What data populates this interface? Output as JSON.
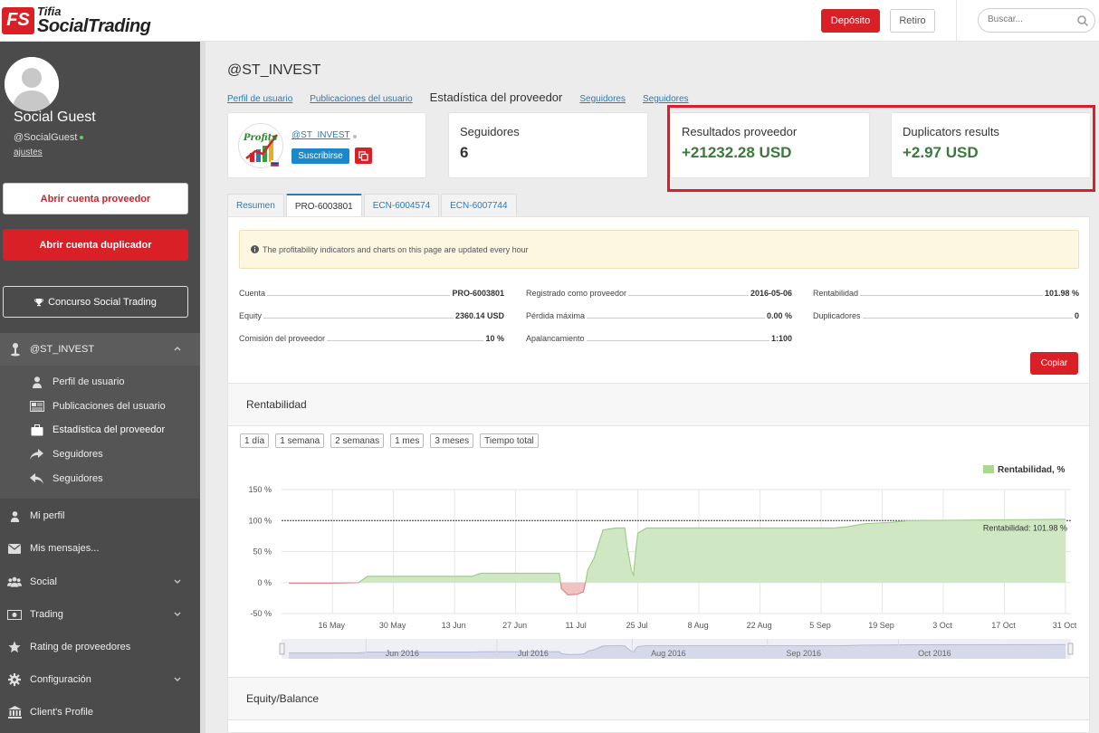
{
  "brand": {
    "line1": "Tifia",
    "line2": "SocialTrading"
  },
  "header": {
    "deposit_label": "Depósito",
    "withdraw_label": "Retiro",
    "search_placeholder": "Buscar..."
  },
  "user": {
    "name": "Social Guest",
    "handle": "@SocialGuest",
    "settings_link": "ajustes"
  },
  "sidebar": {
    "open_provider": "Abrir cuenta proveedor",
    "open_duplicator": "Abrir cuenta duplicador",
    "contest": "Concurso Social Trading",
    "section": {
      "label": "@ST_INVEST",
      "icon": "user-pin-icon"
    },
    "sub_items": [
      {
        "label": "Perfil de usuario",
        "icon": "user-icon"
      },
      {
        "label": "Publicaciones del usuario",
        "icon": "newspaper-icon"
      },
      {
        "label": "Estadística del proveedor",
        "icon": "briefcase-icon"
      },
      {
        "label": "Seguidores",
        "icon": "share-icon"
      },
      {
        "label": "Seguidores",
        "icon": "reply-icon"
      }
    ],
    "items": [
      {
        "label": "Mi perfil",
        "icon": "user-icon"
      },
      {
        "label": "Mis mensajes...",
        "icon": "envelope-icon"
      },
      {
        "label": "Social",
        "icon": "users-icon"
      },
      {
        "label": "Trading",
        "icon": "money-icon"
      },
      {
        "label": "Rating de proveedores",
        "icon": "star-icon"
      },
      {
        "label": "Configuración",
        "icon": "gear-icon"
      },
      {
        "label": "Client's Profile",
        "icon": "bank-icon"
      }
    ]
  },
  "page": {
    "title": "@ST_INVEST",
    "subnav": {
      "profile": "Perfil de usuario",
      "posts": "Publicaciones del usuario",
      "current": "Estadística del proveedor",
      "followers1": "Seguidores",
      "followers2": "Seguidores"
    }
  },
  "provider": {
    "name": "@ST_INVEST",
    "subscribe_label": "Suscribirse",
    "logo_text": "Profits"
  },
  "cards": {
    "followers": {
      "label": "Seguidores",
      "value": "6"
    },
    "provider_results": {
      "label": "Resultados proveedor",
      "value": "+21232.28 USD"
    },
    "duplicators_results": {
      "label": "Duplicators results",
      "value": "+2.97 USD"
    }
  },
  "tabs": [
    "Resumen",
    "PRO-6003801",
    "ECN-6004574",
    "ECN-6007744"
  ],
  "notice": "The profitability indicators and charts on this page are updated every hour",
  "stats": {
    "col1": [
      {
        "k": "Cuenta",
        "v": "PRO-6003801"
      },
      {
        "k": "Equity",
        "v": "2360.14 USD"
      },
      {
        "k": "Comisión del proveedor",
        "v": "10 %"
      }
    ],
    "col2": [
      {
        "k": "Registrado como proveedor",
        "v": "2016-05-06"
      },
      {
        "k": "Pérdida máxima",
        "v": "0.00 %"
      },
      {
        "k": "Apalancamiento",
        "v": "1:100"
      }
    ],
    "col3": [
      {
        "k": "Rentabilidad",
        "v": "101.98 %"
      },
      {
        "k": "Duplicadores",
        "v": "0"
      }
    ]
  },
  "copy_label": "Copiar",
  "sections": {
    "profitability": "Rentabilidad",
    "equity": "Equity/Balance"
  },
  "ranges": [
    "1 día",
    "1 semana",
    "2 semanas",
    "1 mes",
    "3 meses",
    "Tiempo total"
  ],
  "colors": {
    "accent": "#d92027",
    "link": "#2a7ab8",
    "positive": "#3b7a3b",
    "area_pos": "#cfe8c3",
    "area_neg": "#f0c3c3"
  },
  "chart_data": {
    "type": "area",
    "legend": "Rentabilidad, %",
    "legend_position": "top-right",
    "annotation": "Rentabilidad: 101.98 %",
    "reference_line": 100,
    "ylim": [
      -50,
      150
    ],
    "y_ticks": [
      -50,
      0,
      50,
      100,
      150
    ],
    "y_tick_labels": [
      "-50 %",
      "0 %",
      "50 %",
      "100 %",
      "150 %"
    ],
    "x_tick_labels": [
      "16 May",
      "30 May",
      "13 Jun",
      "27 Jun",
      "11 Jul",
      "25 Jul",
      "8 Aug",
      "22 Aug",
      "5 Sep",
      "19 Sep",
      "3 Oct",
      "17 Oct",
      "31 Oct"
    ],
    "x_tick_days": [
      10,
      24,
      38,
      52,
      66,
      80,
      94,
      108,
      122,
      136,
      150,
      164,
      178
    ],
    "xlim_days": [
      0,
      178
    ],
    "x_origin_date": "2016-05-06",
    "navigator_labels": [
      "Jun 2016",
      "Jul 2016",
      "Aug 2016",
      "Sep 2016",
      "Oct 2016"
    ],
    "navigator_days": [
      26,
      56,
      87,
      118,
      148
    ],
    "points": [
      [
        0,
        -1
      ],
      [
        10,
        -1
      ],
      [
        16,
        0
      ],
      [
        18,
        10
      ],
      [
        42,
        10
      ],
      [
        44,
        15
      ],
      [
        60,
        15
      ],
      [
        62,
        15
      ],
      [
        62.5,
        -10
      ],
      [
        64,
        -20
      ],
      [
        66,
        -19
      ],
      [
        67.5,
        -15
      ],
      [
        68,
        0
      ],
      [
        68.5,
        20
      ],
      [
        70,
        40
      ],
      [
        72,
        85
      ],
      [
        75,
        88
      ],
      [
        77,
        88
      ],
      [
        77.5,
        60
      ],
      [
        78.5,
        20
      ],
      [
        79,
        12
      ],
      [
        79.5,
        50
      ],
      [
        80,
        80
      ],
      [
        82,
        88
      ],
      [
        90,
        88
      ],
      [
        95,
        88
      ],
      [
        105,
        88
      ],
      [
        115,
        88
      ],
      [
        125,
        88
      ],
      [
        128,
        90
      ],
      [
        132,
        95
      ],
      [
        138,
        97
      ],
      [
        142,
        100
      ],
      [
        178,
        101.98
      ]
    ]
  }
}
